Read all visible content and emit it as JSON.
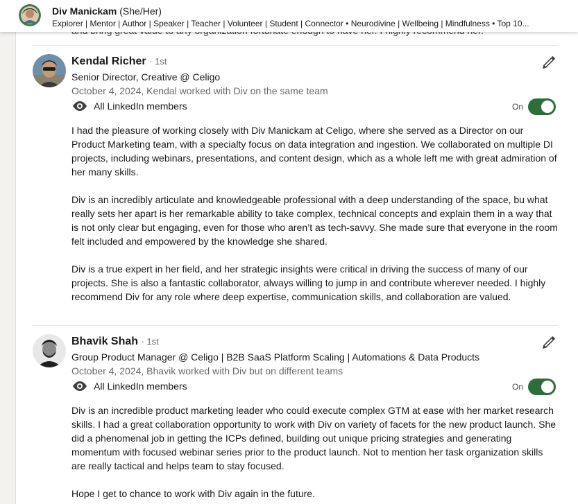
{
  "profile_bar": {
    "name": "Div Manickam",
    "pronouns": "(She/Her)",
    "headline": "Explorer | Mentor | Author | Speaker | Teacher | Volunteer | Student | Connector • Neurodivine | Wellbeing | Mindfulness • Top 10..."
  },
  "cut_text": "and bring great value to any organization fortunate enough to have her. I highly recommend her.",
  "recommendations": [
    {
      "name": "Kendal Richer",
      "degree": "· 1st",
      "title": "Senior Director, Creative @ Celigo",
      "meta": "October 4, 2024, Kendal worked with Div on the same team",
      "visibility": "All LinkedIn members",
      "toggle_label": "On",
      "toggle_on": true,
      "paragraphs": [
        "I had the pleasure of working closely with Div Manickam at Celigo, where she served as a Director on our Product Marketing team, with a specialty focus on data integration and ingestion. We collaborated on multiple DI projects, including webinars, presentations, and content design, which as a whole left me with great admiration of her many skills.",
        "Div is an incredibly articulate and knowledgeable professional with a deep understanding of the space, bu what really sets her apart is her remarkable ability to take complex, technical concepts and explain them in a way that is not only clear but engaging, even for those who aren’t as tech-savvy. She made sure that everyone in the room felt included and empowered by the knowledge she shared.",
        "Div is a true expert in her field, and her strategic insights were critical in driving the success of many of our projects. She is also a fantastic collaborator, always willing to jump in and contribute wherever needed. I highly recommend Div for any role where deep expertise, communication skills, and collaboration are valued."
      ]
    },
    {
      "name": "Bhavik Shah",
      "degree": "· 1st",
      "title": "Group Product Manager @ Celigo | B2B SaaS Platform Scaling | Automations & Data Products",
      "meta": "October 4, 2024, Bhavik worked with Div but on different teams",
      "visibility": "All LinkedIn members",
      "toggle_label": "On",
      "toggle_on": true,
      "paragraphs": [
        "Div is an incredible product marketing leader who could execute complex GTM at ease with her market research skills. I had a great collaboration opportunity to work with Div on variety of facets for the new product launch. She did a phenomenal job in getting the ICPs defined, building out unique pricing strategies and generating momentum with focused webinar series prior to the product launch. Not to mention her task organization skills are really tactical and helps team to stay focused.",
        "Hope I get to chance to work with Div again in the future."
      ]
    }
  ],
  "icons": {
    "edit": "pencil-icon",
    "visibility": "eye-icon"
  },
  "colors": {
    "toggle_on": "#2f6e3b",
    "page_bg": "#f4f2ee",
    "card_bg": "#ffffff"
  }
}
